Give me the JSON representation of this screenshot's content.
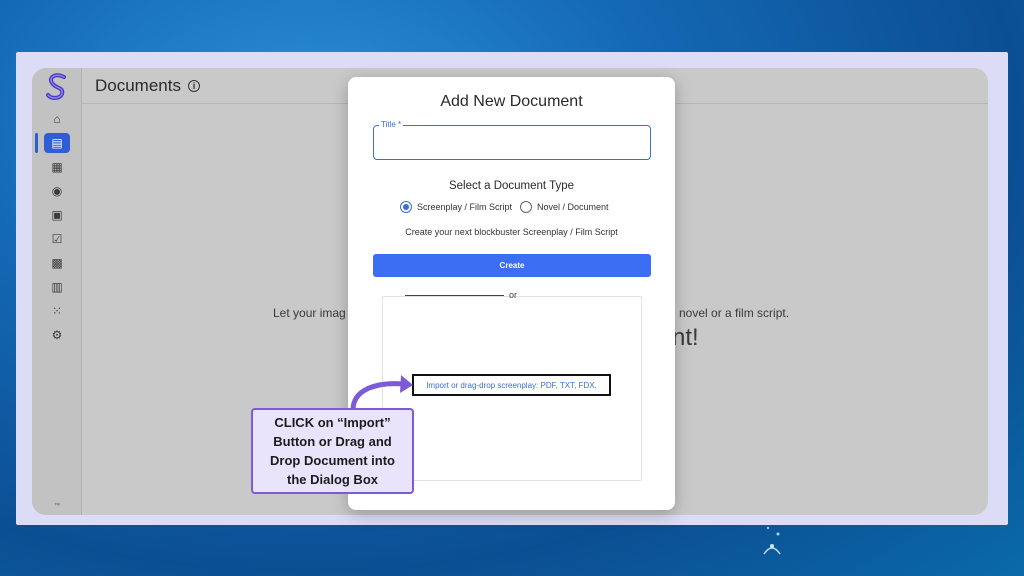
{
  "page": {
    "title": "Documents"
  },
  "sidebar": {
    "items": [
      {
        "name": "home",
        "icon": "home-icon",
        "glyph": "⌂"
      },
      {
        "name": "documents",
        "icon": "document-icon",
        "glyph": "▤",
        "active": true
      },
      {
        "name": "scenes",
        "icon": "clapperboard-icon",
        "glyph": "▦"
      },
      {
        "name": "reels",
        "icon": "film-reel-icon",
        "glyph": "◉"
      },
      {
        "name": "schedule",
        "icon": "clipboard-clock-icon",
        "glyph": "▣"
      },
      {
        "name": "tasks",
        "icon": "checklist-icon",
        "glyph": "☑"
      },
      {
        "name": "contacts",
        "icon": "contact-card-icon",
        "glyph": "▩"
      },
      {
        "name": "reports",
        "icon": "bar-chart-icon",
        "glyph": "▥"
      },
      {
        "name": "apps",
        "icon": "grid-icon",
        "glyph": "⁙"
      },
      {
        "name": "settings",
        "icon": "gear-icon",
        "glyph": "⚙"
      }
    ],
    "footer": "™"
  },
  "background": {
    "heading_fragment": "nt!",
    "subtitle_left": "Let your imag",
    "subtitle_right": "novel or a film script."
  },
  "modal": {
    "title": "Add New Document",
    "title_field": {
      "label": "Title *",
      "value": ""
    },
    "type_heading": "Select a Document Type",
    "options": [
      {
        "label": "Screenplay / Film Script",
        "selected": true
      },
      {
        "label": "Novel / Document",
        "selected": false
      }
    ],
    "description": "Create your next blockbuster Screenplay / Film Script",
    "create_label": "Create",
    "or_text": "or",
    "import_text": "Import or drag-drop screenplay: PDF, TXT, FDX."
  },
  "callout": {
    "text": "CLICK on “Import” Button or Drag and Drop Document into the Dialog Box"
  },
  "colors": {
    "accent": "#3b6ef2",
    "callout_border": "#7b5bd6",
    "callout_bg": "#e9e3fb"
  }
}
